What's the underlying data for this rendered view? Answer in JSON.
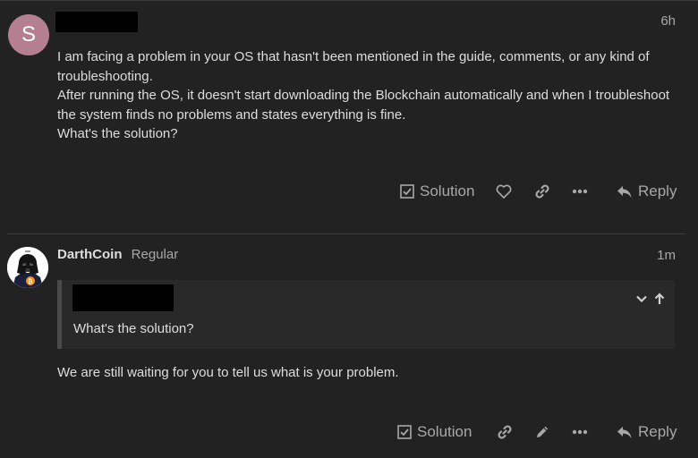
{
  "post1": {
    "avatar_letter": "S",
    "avatar_color": "#b47f90",
    "date": "6h",
    "paragraphs": [
      "I am facing a problem in your OS that hasn't been mentioned in the guide, comments, or any kind of troubleshooting.",
      "After running the OS, it doesn't start downloading the Blockchain automatically and when I troubleshoot the system finds no problems and states everything is fine.",
      "What's the solution?"
    ],
    "actions": {
      "solution_label": "Solution",
      "reply_label": "Reply"
    }
  },
  "post2": {
    "username": "DarthCoin",
    "user_title": "Regular",
    "date": "1m",
    "quote_text": "What's the solution?",
    "body": "We are still waiting for you to tell us what is your problem.",
    "actions": {
      "solution_label": "Solution",
      "reply_label": "Reply"
    }
  },
  "colors": {
    "background": "#222222",
    "text": "#dddddd",
    "muted": "#a8a8a8"
  }
}
